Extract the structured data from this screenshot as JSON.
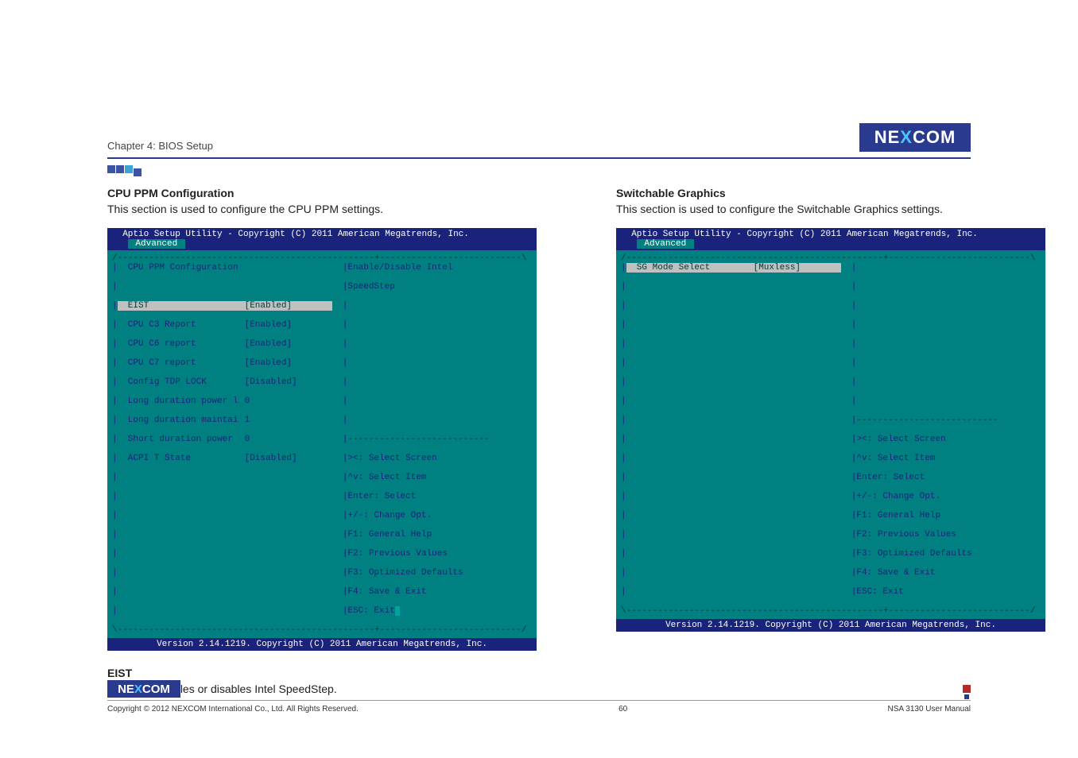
{
  "header": {
    "chapter": "Chapter 4: BIOS Setup",
    "logo_text_1": "NE",
    "logo_text_x": "X",
    "logo_text_2": "COM"
  },
  "left": {
    "title": "CPU PPM Configuration",
    "desc": "This section is used to configure the CPU PPM settings.",
    "bios_top": "  Aptio Setup Utility - Copyright (C) 2011 American Megatrends, Inc.",
    "bios_tab": " Advanced ",
    "section_label": "  CPU PPM Configuration",
    "help1": "Enable/Disable Intel",
    "help2": "SpeedStep",
    "rows": [
      {
        "label": "  EIST",
        "value": "[Enabled]",
        "hl": true
      },
      {
        "label": "  CPU C3 Report",
        "value": "[Enabled]"
      },
      {
        "label": "  CPU C6 report",
        "value": "[Enabled]"
      },
      {
        "label": "  CPU C7 report",
        "value": "[Enabled]"
      },
      {
        "label": "  Config TDP LOCK",
        "value": "[Disabled]"
      },
      {
        "label": "  Long duration power l",
        "value": "0"
      },
      {
        "label": "  Long duration maintai",
        "value": "1"
      },
      {
        "label": "  Short duration power",
        "value": "0"
      },
      {
        "label": "  ACPI T State",
        "value": "[Disabled]"
      }
    ],
    "keys": [
      "><: Select Screen",
      "^v: Select Item",
      "Enter: Select",
      "+/-: Change Opt.",
      "F1: General Help",
      "F2: Previous Values",
      "F3: Optimized Defaults",
      "F4: Save & Exit",
      "ESC: Exit"
    ],
    "bios_btm": "Version 2.14.1219. Copyright (C) 2011 American Megatrends, Inc.",
    "sub_title": "EIST",
    "sub_desc": "This item enables or disables Intel SpeedStep."
  },
  "right": {
    "title": "Switchable Graphics",
    "desc": "This section is used to configure the Switchable Graphics settings.",
    "bios_top": "  Aptio Setup Utility - Copyright (C) 2011 American Megatrends, Inc.",
    "bios_tab": " Advanced ",
    "row_label": "  SG Mode Select",
    "row_value": "[Muxless]",
    "keys": [
      "><: Select Screen",
      "^v: Select Item",
      "Enter: Select",
      "+/-: Change Opt.",
      "F1: General Help",
      "F2: Previous Values",
      "F3: Optimized Defaults",
      "F4: Save & Exit",
      "ESC: Exit"
    ],
    "bios_btm": "Version 2.14.1219. Copyright (C) 2011 American Megatrends, Inc."
  },
  "footer": {
    "left": "Copyright © 2012 NEXCOM International Co., Ltd. All Rights Reserved.",
    "mid": "60",
    "right": "NSA 3130 User Manual"
  }
}
